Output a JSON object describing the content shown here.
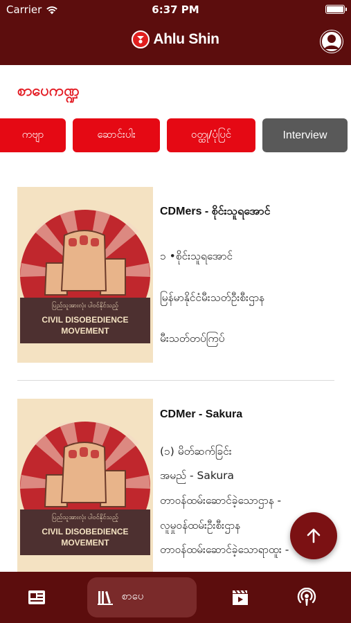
{
  "status_bar": {
    "carrier": "Carrier",
    "time": "6:37 PM"
  },
  "header": {
    "app_name": "Ahlu Shin"
  },
  "page": {
    "title": "စာပေကဏ္ဍ"
  },
  "categories": [
    {
      "label": "ကဗျာ",
      "active": false
    },
    {
      "label": "ဆောင်းပါး",
      "active": false
    },
    {
      "label": "ဝတ္ထု/ပုံပြင်",
      "active": false
    },
    {
      "label": "Interview",
      "active": true
    }
  ],
  "articles": [
    {
      "title": "CDMers - စိုင်းသူရအောင်",
      "lines": [
        "၁ •စိုင်းသူရအောင်",
        "မြန်မာနိုင်ငံမီးသတ်ဦးစီးဌာန",
        "မီးသတ်တပ်ကြပ်"
      ],
      "image_top_text": "ပြည်သူအားလုံး ပါဝင်နိုင်သည့်",
      "image_main_text_1": "CIVIL DISOBEDIENCE",
      "image_main_text_2": "MOVEMENT"
    },
    {
      "title": "CDMer - Sakura",
      "lines": [
        "(၁) မိတ်ဆက်ခြင်း",
        "အမည်      - Sakura",
        "တာဝန်ထမ်းဆောင်ခဲ့သောဌာန -",
        "လူမှုဝန်ထမ်းဦးစီးဌာန",
        "တာဝန်ထမ်းဆောင်ခဲ့သောရာထူး -"
      ],
      "image_top_text": "ပြည်သူအားလုံး ပါဝင်နိုင်သည့်",
      "image_main_text_1": "CIVIL DISOBEDIENCE",
      "image_main_text_2": "MOVEMENT"
    }
  ],
  "bottom_nav": {
    "items": [
      {
        "icon": "news-icon"
      },
      {
        "icon": "library-icon",
        "label": "စာပေ",
        "active": true
      },
      {
        "icon": "video-icon"
      },
      {
        "icon": "podcast-icon"
      }
    ]
  },
  "colors": {
    "header": "#5c0d0d",
    "accent": "#e50914",
    "active_chip": "#595959",
    "title": "#e31b23"
  }
}
